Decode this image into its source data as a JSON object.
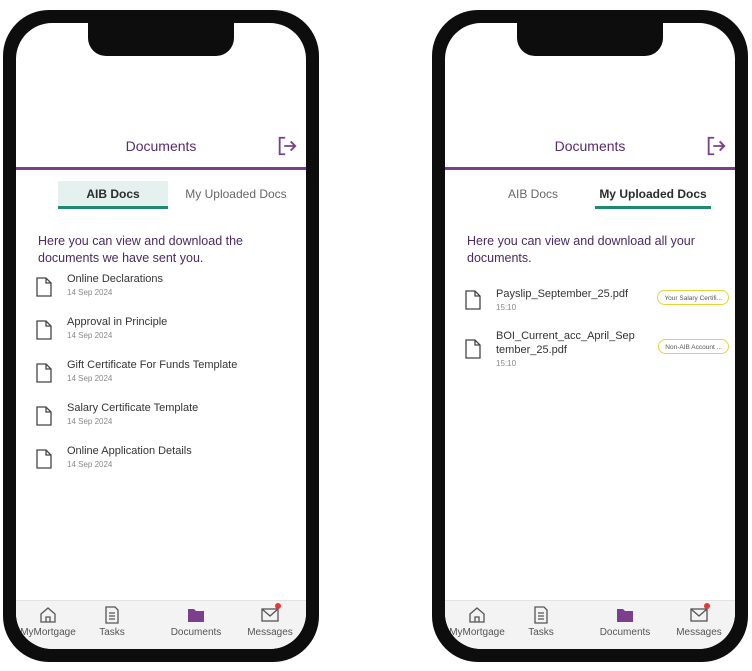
{
  "left_phone": {
    "header": {
      "title": "Documents"
    },
    "tabs": [
      {
        "label": "AIB Docs",
        "active": true
      },
      {
        "label": "My Uploaded Docs",
        "active": false
      }
    ],
    "intro": "Here you can view and download the documents we have sent you.",
    "documents": [
      {
        "title": "Online Declarations",
        "date": "14 Sep 2024"
      },
      {
        "title": "Approval in Principle",
        "date": "14 Sep 2024"
      },
      {
        "title": "Gift Certificate For Funds Template",
        "date": "14 Sep 2024"
      },
      {
        "title": "Salary Certificate Template",
        "date": "14 Sep 2024"
      },
      {
        "title": "Online Application Details",
        "date": "14 Sep 2024"
      }
    ]
  },
  "right_phone": {
    "header": {
      "title": "Documents"
    },
    "tabs": [
      {
        "label": "AIB Docs",
        "active": false
      },
      {
        "label": "My Uploaded Docs",
        "active": true
      }
    ],
    "intro": "Here you can view and download all your documents.",
    "documents": [
      {
        "title": "Payslip_September_25.pdf",
        "time": "15:10",
        "tag": "Your Salary Certifi..."
      },
      {
        "title": "BOI_Current_acc_April_September_25.pdf",
        "time": "15:10",
        "tag": "Non-AIB Account ..."
      }
    ]
  },
  "nav": {
    "items": [
      {
        "label": "MyMortgage",
        "icon": "home-icon"
      },
      {
        "label": "Tasks",
        "icon": "tasks-icon"
      },
      {
        "label": "Documents",
        "icon": "folder-icon",
        "active": true
      },
      {
        "label": "Messages",
        "icon": "messages-icon",
        "has_notification": true
      }
    ]
  },
  "colors": {
    "accent_purple": "#7b3f8c",
    "tab_underline_green": "#1f8a70",
    "badge_border_yellow": "#e6d33a",
    "notification_red": "#e53935"
  }
}
